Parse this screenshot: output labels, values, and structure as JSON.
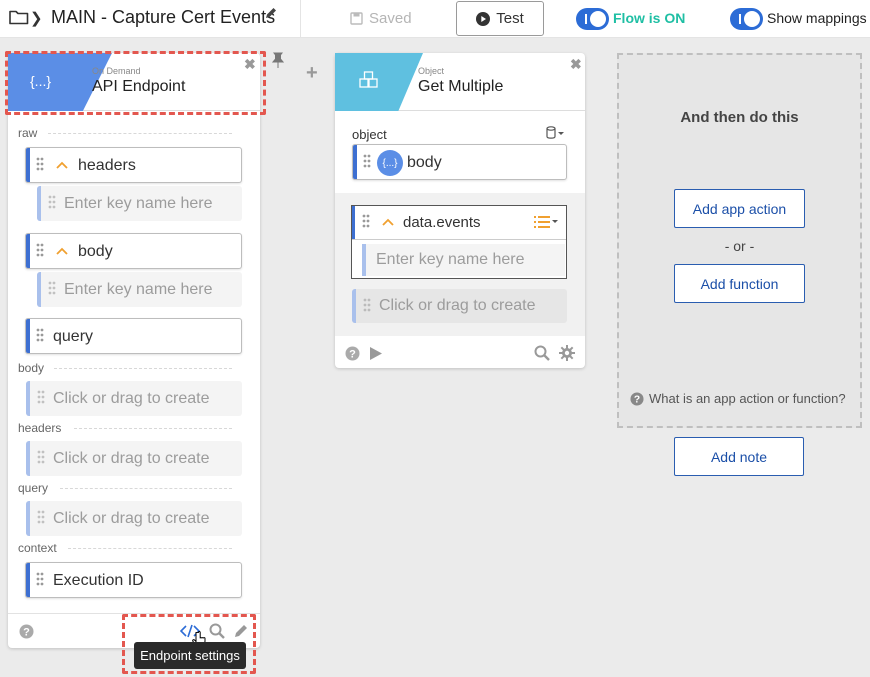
{
  "topbar": {
    "flow_title": "MAIN - Capture Cert Events",
    "saved_label": "Saved",
    "test_label": "Test",
    "flow_status_label": "Flow is ON",
    "show_mappings_label": "Show mappings"
  },
  "trigger_card": {
    "subtitle": "On Demand",
    "title": "API Endpoint",
    "header_icon_text": "{...}",
    "sections": {
      "raw": "raw",
      "body": "body",
      "headers": "headers",
      "query": "query",
      "context": "context"
    },
    "raw_items": {
      "headers": "headers",
      "headers_key_placeholder": "Enter key name here",
      "body": "body",
      "body_key_placeholder": "Enter key name here",
      "query": "query"
    },
    "click_or_drag": "Click or drag to create",
    "execution_id": "Execution ID",
    "tooltip": "Endpoint settings"
  },
  "object_card": {
    "subtitle": "Object",
    "title": "Get Multiple",
    "object_label": "object",
    "body_chip_icon_text": "{...}",
    "body_label": "body",
    "events_label": "data.events",
    "events_key_placeholder": "Enter key name here",
    "click_or_drag": "Click or drag to create"
  },
  "next_step_panel": {
    "title": "And then do this",
    "add_app_action": "Add app action",
    "or_text": "- or -",
    "add_function": "Add function",
    "help_link": "What is an app action or function?"
  },
  "add_note_label": "Add note",
  "colors": {
    "accent_blue": "#3d6fd1",
    "trigger_header": "#5b8ee6",
    "object_header": "#5fc0e0",
    "flow_on_green": "#1fbfa4",
    "highlight_red": "#e3574f",
    "caret_orange": "#f0a030"
  },
  "icons": [
    "folder-icon",
    "chevron-right-icon",
    "pencil-icon",
    "save-icon",
    "play-icon",
    "pin-icon",
    "close-icon",
    "drag-handle-icon",
    "chevron-up-icon",
    "database-icon",
    "list-icon",
    "help-icon",
    "search-icon",
    "gear-icon",
    "code-icon",
    "hand-cursor-icon"
  ]
}
